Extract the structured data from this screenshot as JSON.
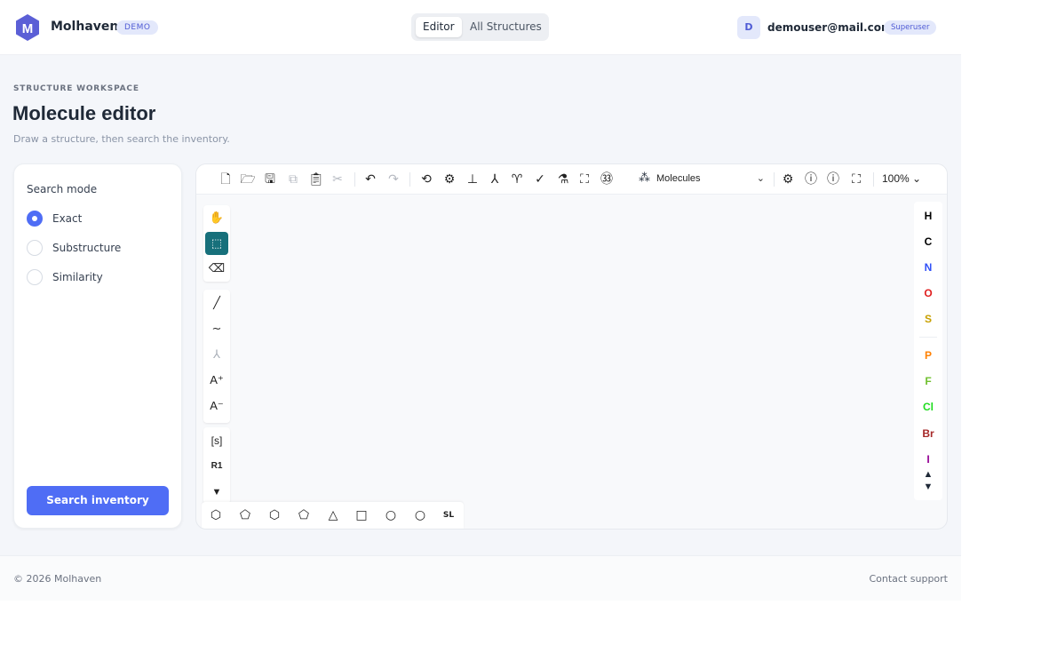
{
  "header": {
    "brand": "Molhaven",
    "demo_badge": "DEMO",
    "logo_letter": "M",
    "nav": [
      {
        "label": "Editor"
      },
      {
        "label": "All Structures"
      }
    ],
    "user_initial": "D",
    "user_email": "demouser@mail.com",
    "role": "Superuser"
  },
  "page": {
    "eyebrow": "STRUCTURE WORKSPACE",
    "title": "Molecule editor",
    "subtitle": "Draw a structure, then search the inventory."
  },
  "search": {
    "title": "Search mode",
    "options": [
      {
        "label": "Exact",
        "selected": true
      },
      {
        "label": "Substructure",
        "selected": false
      },
      {
        "label": "Similarity",
        "selected": false
      }
    ],
    "button": "Search inventory"
  },
  "editor": {
    "mode_label": "Molecules",
    "zoom": "100%",
    "left_tools": {
      "charge_plus": "A⁺",
      "charge_minus": "A⁻",
      "sgroup": "[s]",
      "rgroup": "R1"
    },
    "template_sl": "SL",
    "elements": [
      "H",
      "C",
      "N",
      "O",
      "S",
      "P",
      "F",
      "Cl",
      "Br",
      "I"
    ],
    "element_colors": {
      "H": "#000000",
      "C": "#000000",
      "N": "#3050f8",
      "O": "#e02020",
      "S": "#c8a000",
      "P": "#ff8000",
      "F": "#70c030",
      "Cl": "#1fdc1f",
      "Br": "#a62929",
      "I": "#940094"
    }
  },
  "colors": {
    "accent": "#4f6df5",
    "brand": "#5b5fd6",
    "active_tool": "#17707b"
  },
  "footer": {
    "copyright": "© 2026 Molhaven",
    "contact": "Contact support"
  }
}
